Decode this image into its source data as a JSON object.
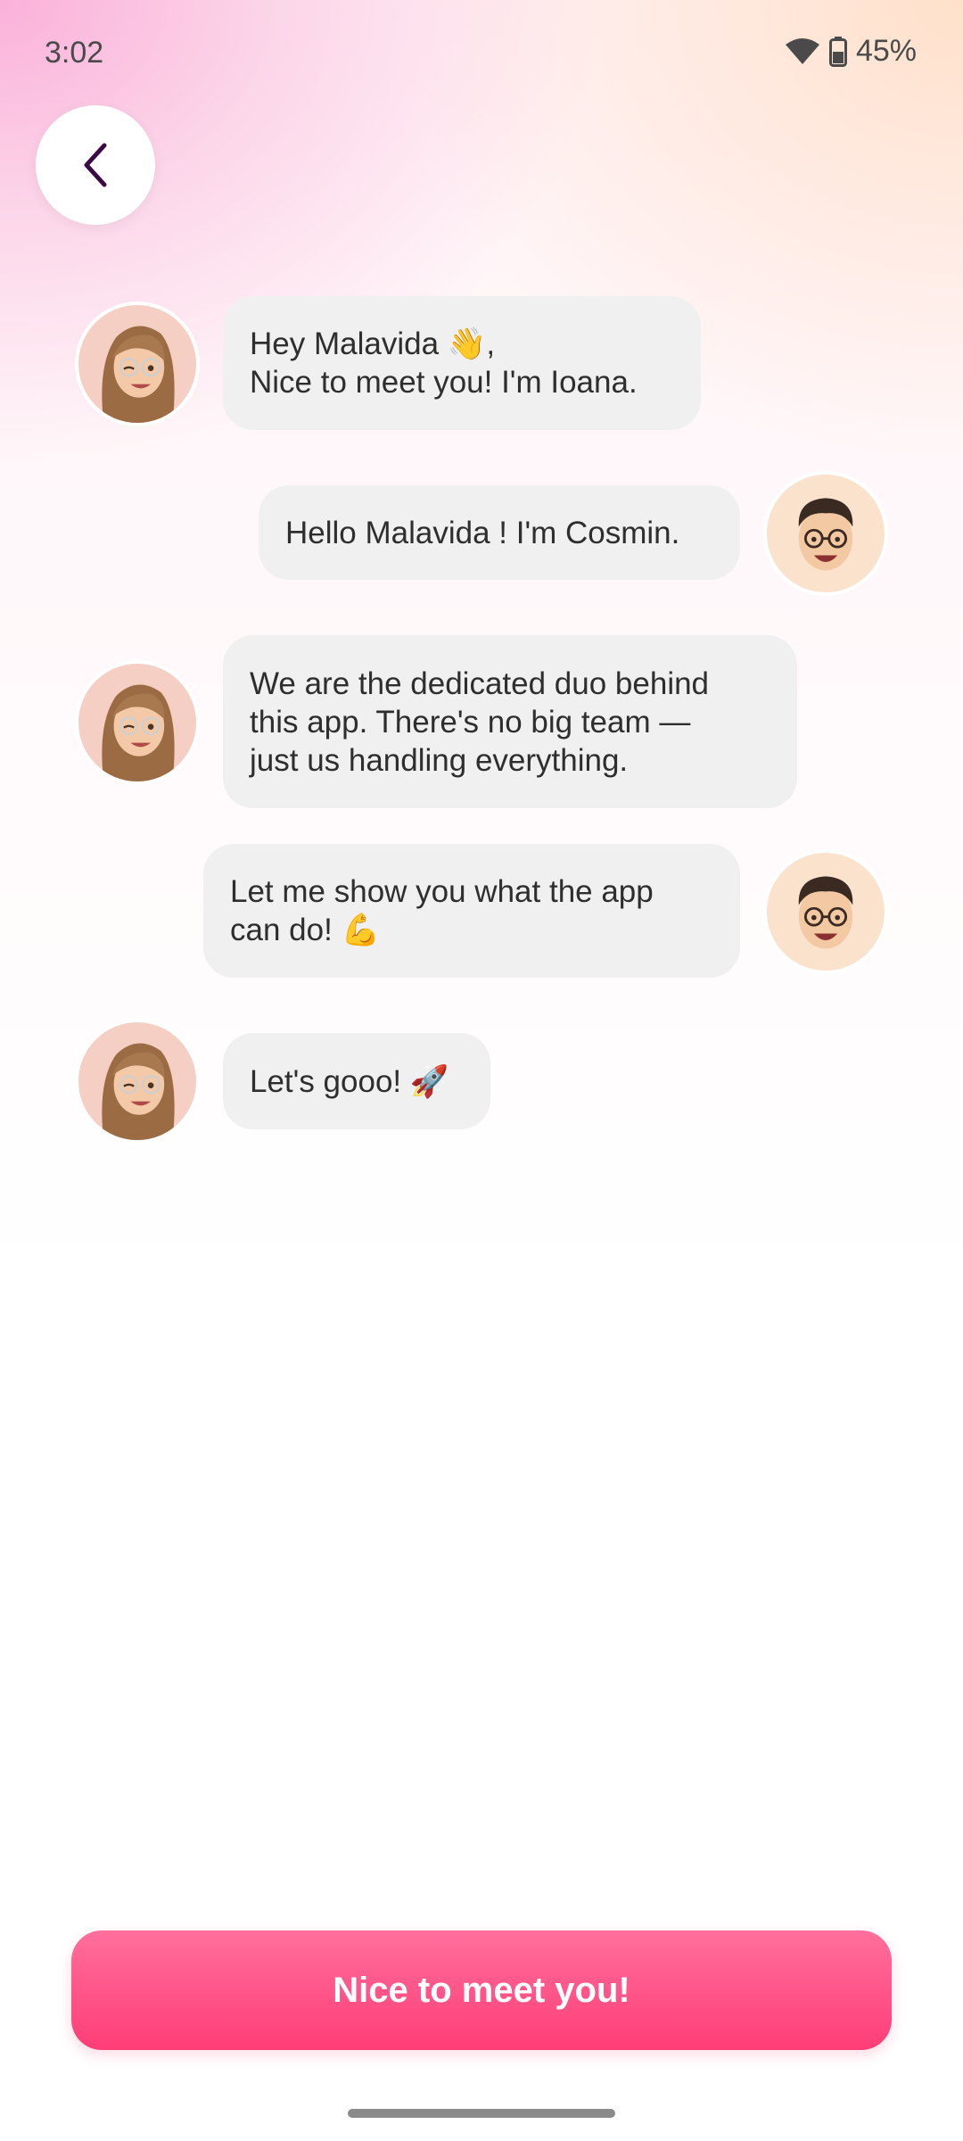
{
  "status_bar": {
    "time": "3:02",
    "battery": "45%",
    "icons": [
      "wifi-icon",
      "battery-icon"
    ]
  },
  "nav": {
    "back_icon": "chevron-left-icon"
  },
  "messages": [
    {
      "sender": "Ioana",
      "side": "left",
      "text": "Hey Malavida 👋,\nNice to meet you! I'm Ioana."
    },
    {
      "sender": "Cosmin",
      "side": "right",
      "text": "Hello Malavida ! I'm Cosmin."
    },
    {
      "sender": "Ioana",
      "side": "left",
      "text": "We are the dedicated duo behind\nthis app. There's no big team —\njust us handling everything."
    },
    {
      "sender": "Cosmin",
      "side": "right",
      "text": "Let me show you what the app\ncan do! 💪"
    },
    {
      "sender": "Ioana",
      "side": "left",
      "text": "Let's gooo! 🚀"
    }
  ],
  "cta": {
    "label": "Nice to meet you!"
  },
  "colors": {
    "accent": "#ff4f85",
    "bubble": "#f0f0f0",
    "back_icon": "#3b0a45"
  }
}
